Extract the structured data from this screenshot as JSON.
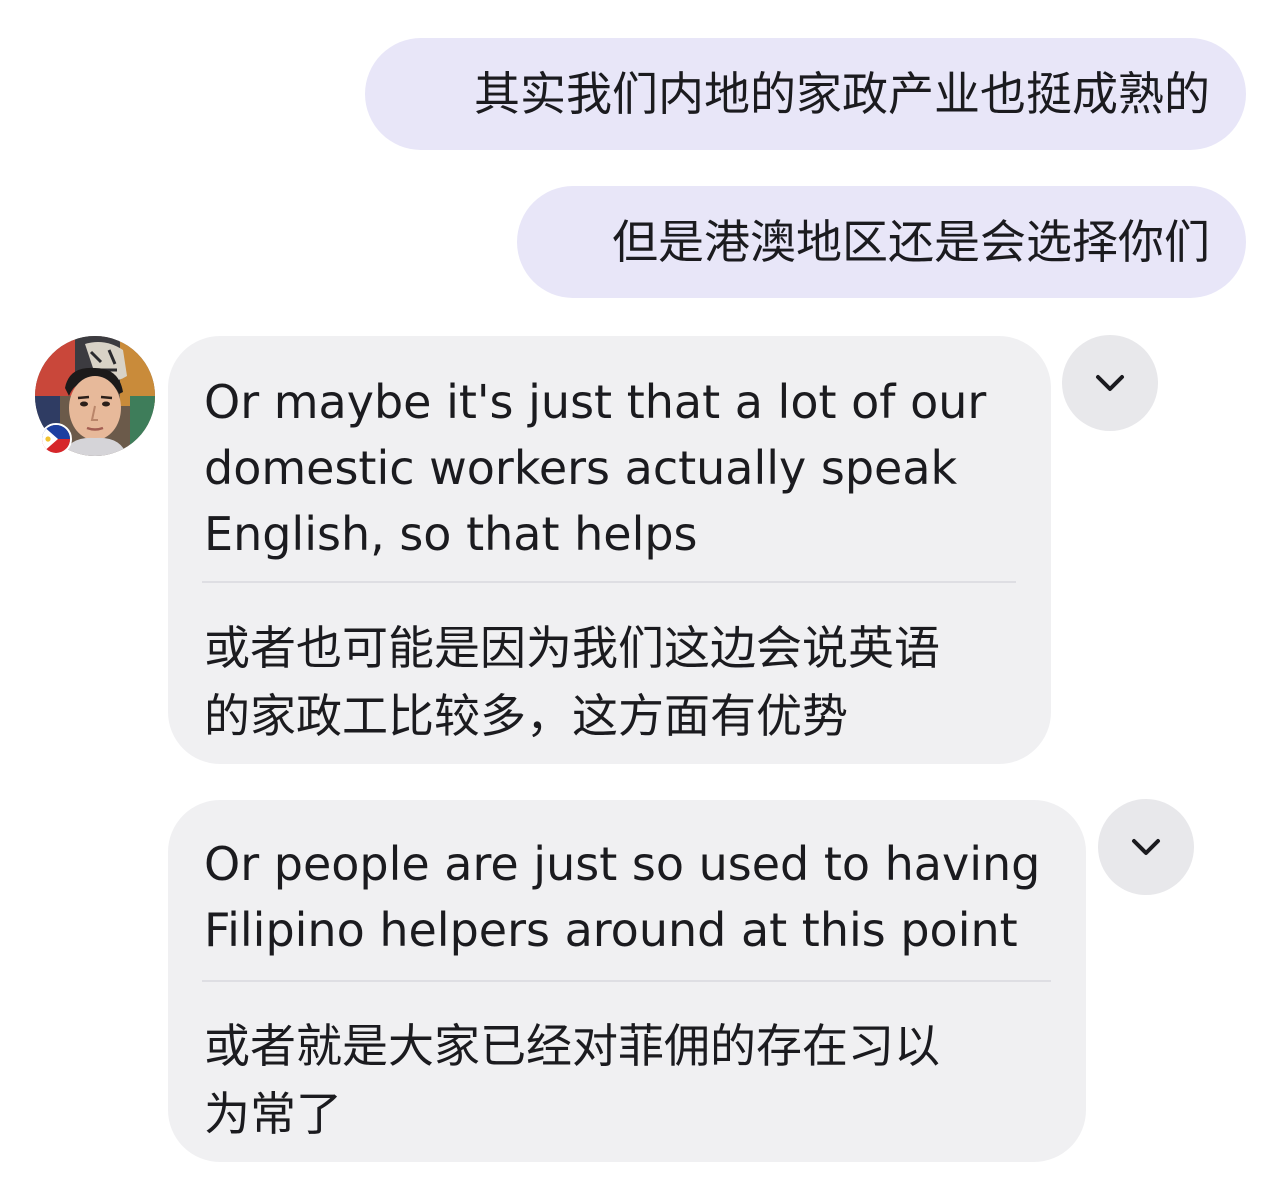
{
  "conversation": {
    "outgoing": [
      {
        "text": "其实我们内地的家政产业也挺成熟的"
      },
      {
        "text": "但是港澳地区还是会选择你们"
      }
    ],
    "incoming": [
      {
        "original_lines": [
          "Or maybe it's just that a lot of our",
          "domestic workers actually speak",
          "English, so that helps"
        ],
        "translation_lines": [
          "或者也可能是因为我们这边会说英语",
          "的家政工比较多，这方面有优势"
        ],
        "options_icon": "chevron-down-icon"
      },
      {
        "original_lines": [
          "Or people are just so used to having",
          "Filipino helpers around at this point"
        ],
        "translation_lines": [
          "或者就是大家已经对菲佣的存在习以",
          "为常了"
        ],
        "options_icon": "chevron-down-icon"
      }
    ],
    "contact": {
      "avatar_icon": "avatar-photo",
      "badge_icon": "philippines-flag-icon"
    }
  },
  "colors": {
    "outgoing_bubble": "#e8e6f8",
    "incoming_bubble": "#f0f0f2",
    "option_button": "#e8e8eb",
    "divider": "#dedee3",
    "text": "#1b1b1f"
  }
}
